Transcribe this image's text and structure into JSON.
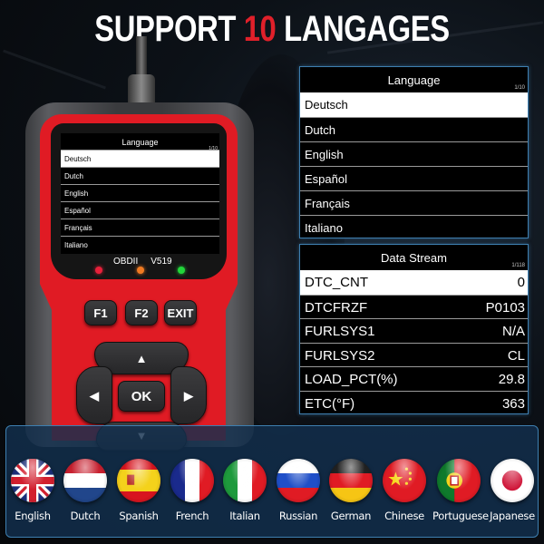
{
  "headline": {
    "part1": "SUPPORT",
    "number": "10",
    "part2": "LANGAGES"
  },
  "colors": {
    "accent": "#e0202a",
    "device_red": "#e01b24",
    "panel_border": "#3e7fb0"
  },
  "device": {
    "screen": {
      "title": "Language",
      "counter": "1/10",
      "items": [
        "Deutsch",
        "Dutch",
        "English",
        "Español",
        "Français",
        "Italiano"
      ],
      "selected_index": 0
    },
    "model": "OBDII",
    "version": "V519",
    "leds": [
      {
        "name": "red",
        "color": "#e8203a"
      },
      {
        "name": "orange",
        "color": "#f07a22"
      },
      {
        "name": "green",
        "color": "#22d63a"
      }
    ],
    "keys": {
      "f1": "F1",
      "f2": "F2",
      "exit": "EXIT",
      "ok": "OK",
      "up": "▲",
      "down": "▼",
      "left": "◀",
      "right": "▶"
    }
  },
  "language_panel": {
    "title": "Language",
    "counter": "1/10",
    "items": [
      "Deutsch",
      "Dutch",
      "English",
      "Español",
      "Français",
      "Italiano"
    ],
    "selected_index": 0
  },
  "data_stream_panel": {
    "title": "Data Stream",
    "counter": "1/118",
    "rows": [
      {
        "name": "DTC_CNT",
        "value": "0"
      },
      {
        "name": "DTCFRZF",
        "value": "P0103"
      },
      {
        "name": "FURLSYS1",
        "value": "N/A"
      },
      {
        "name": "FURLSYS2",
        "value": "CL"
      },
      {
        "name": "LOAD_PCT(%)",
        "value": "29.8"
      },
      {
        "name": "ETC(°F)",
        "value": "363"
      }
    ],
    "selected_index": 0
  },
  "flags": [
    {
      "label": "English",
      "icon": "uk-flag-icon"
    },
    {
      "label": "Dutch",
      "icon": "netherlands-flag-icon"
    },
    {
      "label": "Spanish",
      "icon": "spain-flag-icon"
    },
    {
      "label": "French",
      "icon": "france-flag-icon"
    },
    {
      "label": "Italian",
      "icon": "italy-flag-icon"
    },
    {
      "label": "Russian",
      "icon": "russia-flag-icon"
    },
    {
      "label": "German",
      "icon": "germany-flag-icon"
    },
    {
      "label": "Chinese",
      "icon": "china-flag-icon"
    },
    {
      "label": "Portuguese",
      "icon": "portugal-flag-icon"
    },
    {
      "label": "Japanese",
      "icon": "japan-flag-icon"
    }
  ]
}
